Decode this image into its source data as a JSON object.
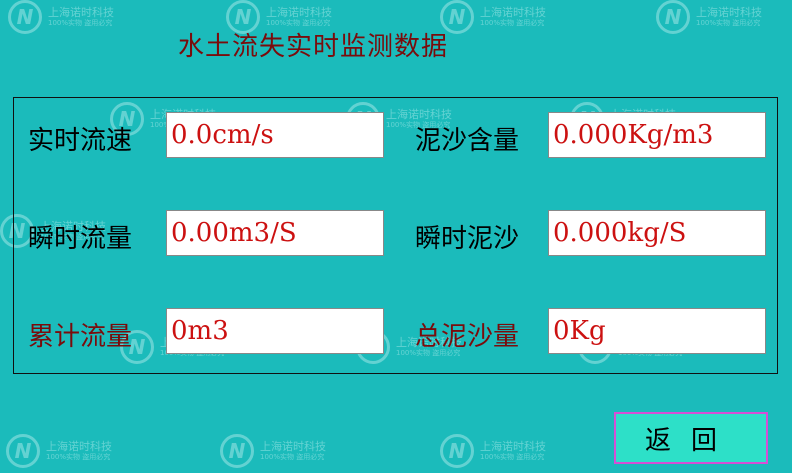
{
  "title": "水土流失实时监测数据",
  "watermark": {
    "logo": "N",
    "line1": "上海诺时科技",
    "line2": "100%实物 盗用必究"
  },
  "fields": {
    "realtime_velocity": {
      "label": "实时流速",
      "value": "0.0cm/s"
    },
    "sediment_content": {
      "label": "泥沙含量",
      "value": "0.000Kg/m3"
    },
    "instant_flow": {
      "label": "瞬时流量",
      "value": "0.00m3/S"
    },
    "instant_sediment": {
      "label": "瞬时泥沙",
      "value": "0.000kg/S"
    },
    "cumulative_flow": {
      "label": "累计流量",
      "value": "0m3"
    },
    "total_sediment": {
      "label": "总泥沙量",
      "value": "0Kg"
    }
  },
  "back_button": {
    "label": "返回"
  },
  "colors": {
    "background": "#1bbbbb",
    "title": "#7a0c0c",
    "value_text": "#cc1111",
    "button": "#2de0c8",
    "button_border": "#d64fd6"
  }
}
